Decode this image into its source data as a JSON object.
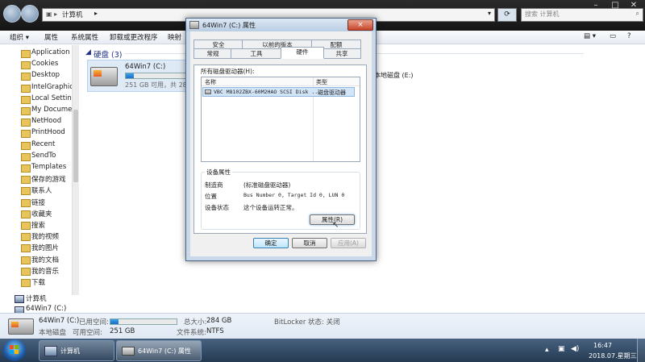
{
  "explorer": {
    "path": [
      "计算机"
    ],
    "search_placeholder": "搜索 计算机",
    "toolbar": [
      "组织 ▾",
      "属性",
      "系统属性",
      "卸载或更改程序",
      "映射"
    ],
    "sidebar_items": [
      "Application D",
      "Cookies",
      "Desktop",
      "IntelGraphicsI",
      "Local Settings",
      "My Document",
      "NetHood",
      "PrintHood",
      "Recent",
      "SendTo",
      "Templates",
      "保存的游戏",
      "联系人",
      "链接",
      "收藏夹",
      "搜索",
      "我的视频",
      "我的图片",
      "我的文档",
      "我的音乐",
      "下载",
      "计算机",
      "64Win7 (C:)"
    ],
    "section_title": "硬盘 (3)",
    "drive": {
      "name": "64Win7 (C:)",
      "free": "251 GB 可用，共 284 GB",
      "used_fraction": 0.12
    },
    "other_drive": "本地磁盘 (E:)"
  },
  "status": {
    "drive_name": "64Win7 (C:)",
    "drive_type": "本地磁盘",
    "used_label": "已用空间:",
    "free_label": "可用空间:",
    "free_value": "251 GB",
    "total_label": "总大小:",
    "total_value": "284 GB",
    "fs_label": "文件系统:",
    "fs_value": "NTFS",
    "bitlocker": "BitLocker 状态: 关闭",
    "used_fraction": 0.12
  },
  "dialog": {
    "title": "64Win7 (C:) 属性",
    "close": "×",
    "tabs_top": [
      "安全",
      "以前的版本",
      "配额"
    ],
    "tabs_bottom": [
      "常规",
      "工具",
      "硬件",
      "共享"
    ],
    "active_tab": "硬件",
    "list_caption": "所有磁盘驱动器(H):",
    "col_name": "名称",
    "col_type": "类型",
    "row_name": "VBC M8102ZBX-60M2HAO SCSI Disk ...",
    "row_type": "磁盘驱动器",
    "props_title": "设备属性",
    "maker_label": "制造商",
    "maker_value": "(标准磁盘驱动器)",
    "location_label": "位置",
    "location_value": "Bus Number 0, Target Id 0, LUN 0",
    "state_label": "设备状态",
    "state_value": "这个设备运转正常。",
    "properties_btn": "属性(R)",
    "ok": "确定",
    "cancel": "取消",
    "apply": "应用(A)"
  },
  "taskbar": {
    "items": [
      "计算机",
      "64Win7 (C:) 属性"
    ],
    "time": "16:47",
    "date": "2018.07.星期三"
  }
}
